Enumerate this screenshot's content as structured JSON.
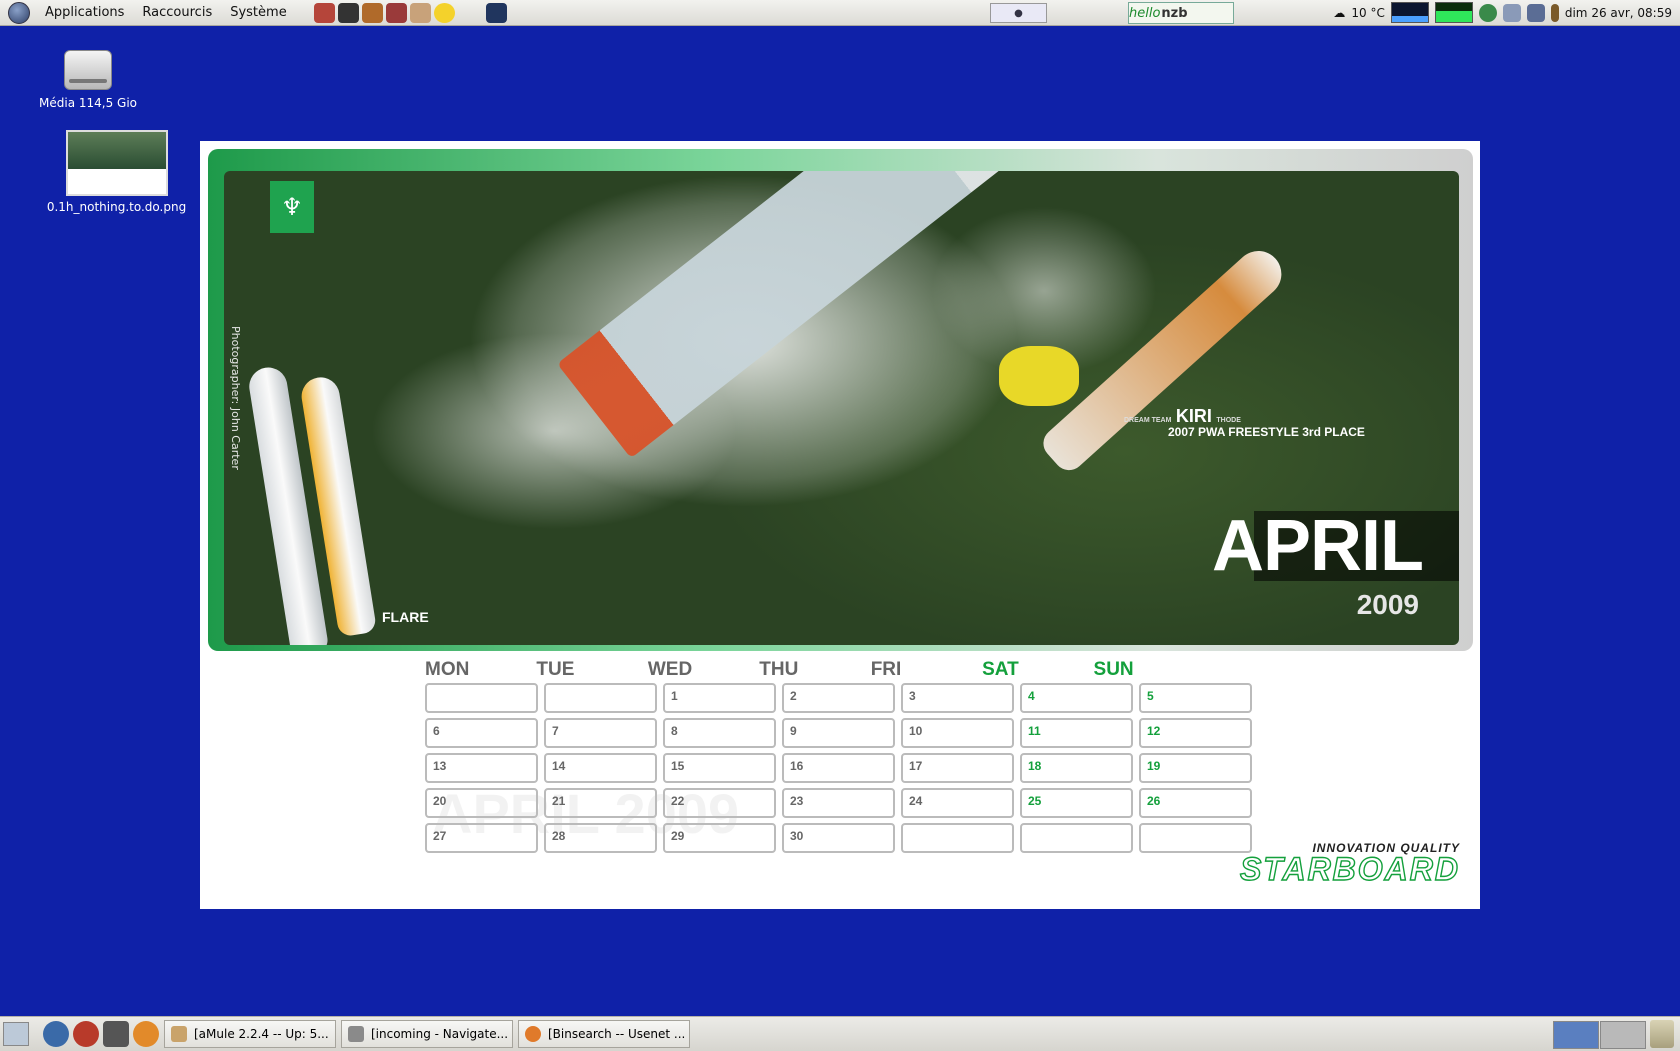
{
  "top_panel": {
    "menus": [
      "Applications",
      "Raccourcis",
      "Système"
    ],
    "weather": "10 °C",
    "datetime": "dim 26 avr, 08:59",
    "hellonzb_prefix": "hello",
    "hellonzb_suffix": "nzb"
  },
  "desktop": {
    "icons": [
      {
        "label": "Média 114,5 Gio"
      },
      {
        "label": "0.1h_nothing.to.do.png"
      }
    ]
  },
  "wallpaper": {
    "photo_credit": "Photographer: John Carter",
    "board_label": "FLARE",
    "rider_team": "DREAM TEAM",
    "rider_first": "KIRI",
    "rider_last": "THODE",
    "rider_result": "2007 PWA FREESTYLE 3rd PLACE",
    "month": "APRIL",
    "year": "2009",
    "watermark": "APRIL 2009",
    "brand_tagline": "INNOVATION QUALITY",
    "brand_name": "STARBOARD",
    "calendar": {
      "days": [
        "MON",
        "TUE",
        "WED",
        "THU",
        "FRI",
        "SAT",
        "SUN"
      ],
      "cells": [
        "",
        "",
        "1",
        "2",
        "3",
        "4",
        "5",
        "6",
        "7",
        "8",
        "9",
        "10",
        "11",
        "12",
        "13",
        "14",
        "15",
        "16",
        "17",
        "18",
        "19",
        "20",
        "21",
        "22",
        "23",
        "24",
        "25",
        "26",
        "27",
        "28",
        "29",
        "30",
        "",
        "",
        ""
      ]
    }
  },
  "taskbar": {
    "tasks": [
      {
        "label": "[aMule 2.2.4 -- Up: 5..."
      },
      {
        "label": "[incoming - Navigate..."
      },
      {
        "label": "[Binsearch -- Usenet ..."
      }
    ]
  },
  "colors": {
    "desktop_bg": "#0f21a8",
    "brand_green": "#14a03c",
    "panel_bg": "#e6e5e0"
  }
}
